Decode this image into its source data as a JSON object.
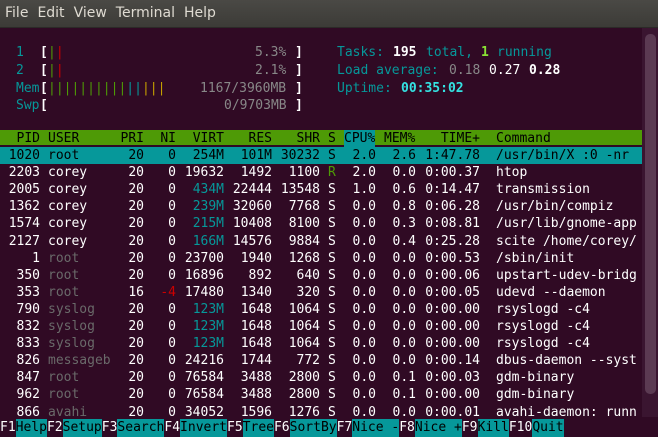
{
  "menubar": {
    "items": [
      "File",
      "Edit",
      "View",
      "Terminal",
      "Help"
    ]
  },
  "meters": {
    "cpu1": {
      "label": "1",
      "percent": "5.3%",
      "bar": "||"
    },
    "cpu2": {
      "label": "2",
      "percent": "2.1%",
      "bar": "||"
    },
    "mem": {
      "label": "Mem",
      "value": "1167/3960MB",
      "bar": "||||||||||||||"
    },
    "swp": {
      "label": "Swp",
      "value": "0/9703MB",
      "bar": ""
    }
  },
  "summary": {
    "tasks_label": "Tasks:",
    "tasks_total": "195",
    "tasks_total_suffix": "total,",
    "tasks_running": "1",
    "tasks_running_suffix": "running",
    "load_label": "Load average:",
    "load_1": "0.18",
    "load_5": "0.27",
    "load_15": "0.28",
    "uptime_label": "Uptime:",
    "uptime_value": "00:35:02"
  },
  "columns": [
    "PID",
    "USER",
    "PRI",
    "NI",
    "VIRT",
    "RES",
    "SHR",
    "S",
    "CPU%",
    "MEM%",
    "TIME+",
    "Command"
  ],
  "processes": [
    {
      "pid": "1020",
      "user": "root",
      "pri": "20",
      "ni": "0",
      "virt": "254M",
      "res": "101M",
      "shr": "30232",
      "s": "S",
      "cpu": "2.0",
      "mem": "2.6",
      "time": "1:47.78",
      "cmd": "/usr/bin/X :0 -nr"
    },
    {
      "pid": "2203",
      "user": "corey",
      "pri": "20",
      "ni": "0",
      "virt": "19632",
      "res": "1492",
      "shr": "1100",
      "s": "R",
      "cpu": "2.0",
      "mem": "0.0",
      "time": "0:00.37",
      "cmd": "htop"
    },
    {
      "pid": "2005",
      "user": "corey",
      "pri": "20",
      "ni": "0",
      "virt": "434M",
      "res": "22444",
      "shr": "13548",
      "s": "S",
      "cpu": "1.0",
      "mem": "0.6",
      "time": "0:14.47",
      "cmd": "transmission"
    },
    {
      "pid": "1362",
      "user": "corey",
      "pri": "20",
      "ni": "0",
      "virt": "239M",
      "res": "32060",
      "shr": "7768",
      "s": "S",
      "cpu": "0.0",
      "mem": "0.8",
      "time": "0:06.28",
      "cmd": "/usr/bin/compiz"
    },
    {
      "pid": "1574",
      "user": "corey",
      "pri": "20",
      "ni": "0",
      "virt": "215M",
      "res": "10408",
      "shr": "8100",
      "s": "S",
      "cpu": "0.0",
      "mem": "0.3",
      "time": "0:08.81",
      "cmd": "/usr/lib/gnome-app"
    },
    {
      "pid": "2127",
      "user": "corey",
      "pri": "20",
      "ni": "0",
      "virt": "166M",
      "res": "14576",
      "shr": "9884",
      "s": "S",
      "cpu": "0.0",
      "mem": "0.4",
      "time": "0:25.28",
      "cmd": "scite /home/corey/"
    },
    {
      "pid": "1",
      "user": "root",
      "pri": "20",
      "ni": "0",
      "virt": "23700",
      "res": "1940",
      "shr": "1268",
      "s": "S",
      "cpu": "0.0",
      "mem": "0.0",
      "time": "0:00.53",
      "cmd": "/sbin/init"
    },
    {
      "pid": "350",
      "user": "root",
      "pri": "20",
      "ni": "0",
      "virt": "16896",
      "res": "892",
      "shr": "640",
      "s": "S",
      "cpu": "0.0",
      "mem": "0.0",
      "time": "0:00.06",
      "cmd": "upstart-udev-bridg"
    },
    {
      "pid": "353",
      "user": "root",
      "pri": "16",
      "ni": "-4",
      "virt": "17480",
      "res": "1340",
      "shr": "320",
      "s": "S",
      "cpu": "0.0",
      "mem": "0.0",
      "time": "0:00.05",
      "cmd": "udevd --daemon"
    },
    {
      "pid": "790",
      "user": "syslog",
      "pri": "20",
      "ni": "0",
      "virt": "123M",
      "res": "1648",
      "shr": "1064",
      "s": "S",
      "cpu": "0.0",
      "mem": "0.0",
      "time": "0:00.00",
      "cmd": "rsyslogd -c4"
    },
    {
      "pid": "832",
      "user": "syslog",
      "pri": "20",
      "ni": "0",
      "virt": "123M",
      "res": "1648",
      "shr": "1064",
      "s": "S",
      "cpu": "0.0",
      "mem": "0.0",
      "time": "0:00.00",
      "cmd": "rsyslogd -c4"
    },
    {
      "pid": "833",
      "user": "syslog",
      "pri": "20",
      "ni": "0",
      "virt": "123M",
      "res": "1648",
      "shr": "1064",
      "s": "S",
      "cpu": "0.0",
      "mem": "0.0",
      "time": "0:00.00",
      "cmd": "rsyslogd -c4"
    },
    {
      "pid": "826",
      "user": "messageb",
      "pri": "20",
      "ni": "0",
      "virt": "24216",
      "res": "1744",
      "shr": "772",
      "s": "S",
      "cpu": "0.0",
      "mem": "0.0",
      "time": "0:00.14",
      "cmd": "dbus-daemon --syst"
    },
    {
      "pid": "847",
      "user": "root",
      "pri": "20",
      "ni": "0",
      "virt": "76584",
      "res": "3488",
      "shr": "2800",
      "s": "S",
      "cpu": "0.0",
      "mem": "0.1",
      "time": "0:00.03",
      "cmd": "gdm-binary"
    },
    {
      "pid": "962",
      "user": "root",
      "pri": "20",
      "ni": "0",
      "virt": "76584",
      "res": "3488",
      "shr": "2800",
      "s": "S",
      "cpu": "0.0",
      "mem": "0.1",
      "time": "0:00.00",
      "cmd": "gdm-binary"
    },
    {
      "pid": "866",
      "user": "avahi",
      "pri": "20",
      "ni": "0",
      "virt": "34052",
      "res": "1596",
      "shr": "1276",
      "s": "S",
      "cpu": "0.0",
      "mem": "0.0",
      "time": "0:00.01",
      "cmd": "avahi-daemon: runn"
    }
  ],
  "function_keys": [
    {
      "key": "F1",
      "label": "Help  "
    },
    {
      "key": "F2",
      "label": "Setup "
    },
    {
      "key": "F3",
      "label": "Search"
    },
    {
      "key": "F4",
      "label": "Invert"
    },
    {
      "key": "F5",
      "label": "Tree  "
    },
    {
      "key": "F6",
      "label": "SortBy"
    },
    {
      "key": "F7",
      "label": "Nice -"
    },
    {
      "key": "F8",
      "label": "Nice +"
    },
    {
      "key": "F9",
      "label": "Kill  "
    },
    {
      "key": "F10",
      "label": "Quit"
    }
  ],
  "colors": {
    "background": "#300a24",
    "header_bar": "#4e9a06",
    "selection": "#06989a"
  }
}
